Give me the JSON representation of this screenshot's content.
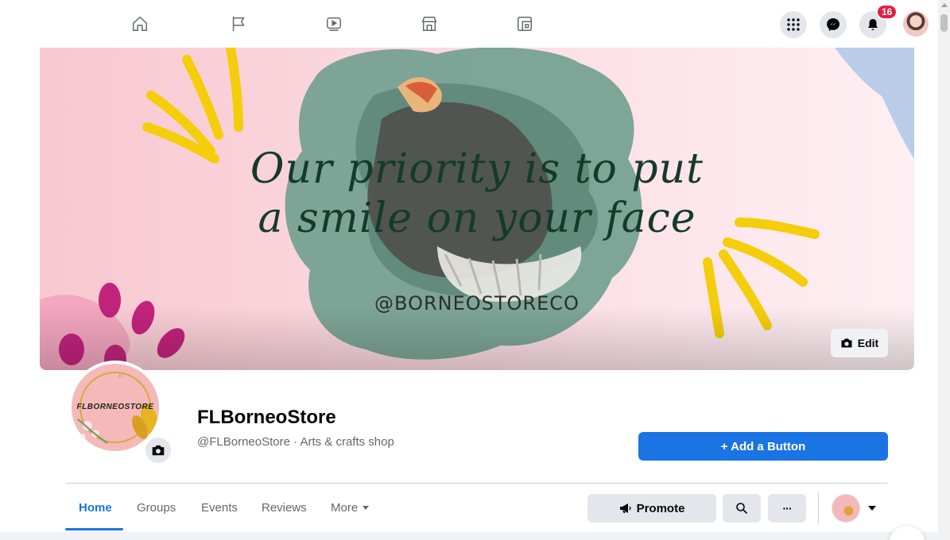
{
  "top_nav": {
    "icons": [
      "home-icon",
      "flag-icon",
      "video-icon",
      "marketplace-icon",
      "gaming-icon"
    ],
    "notification_count": "16"
  },
  "cover": {
    "quote_line1": "Our priority is to put",
    "quote_line2": "a smile on your face",
    "handle_text": "@BORNEOSTORECO",
    "edit_label": "Edit"
  },
  "page": {
    "avatar_text": "FLBORNEOSTORE",
    "name": "FLBorneoStore",
    "subtitle": "@FLBorneoStore · Arts & crafts shop",
    "add_button_label": "+ Add a Button"
  },
  "tabs": [
    {
      "label": "Home",
      "active": true
    },
    {
      "label": "Groups"
    },
    {
      "label": "Events"
    },
    {
      "label": "Reviews"
    },
    {
      "label": "More"
    }
  ],
  "actions": {
    "promote_label": "Promote",
    "more_label": "···"
  },
  "colors": {
    "accent": "#1b74e4",
    "badge": "#e41e3f"
  }
}
